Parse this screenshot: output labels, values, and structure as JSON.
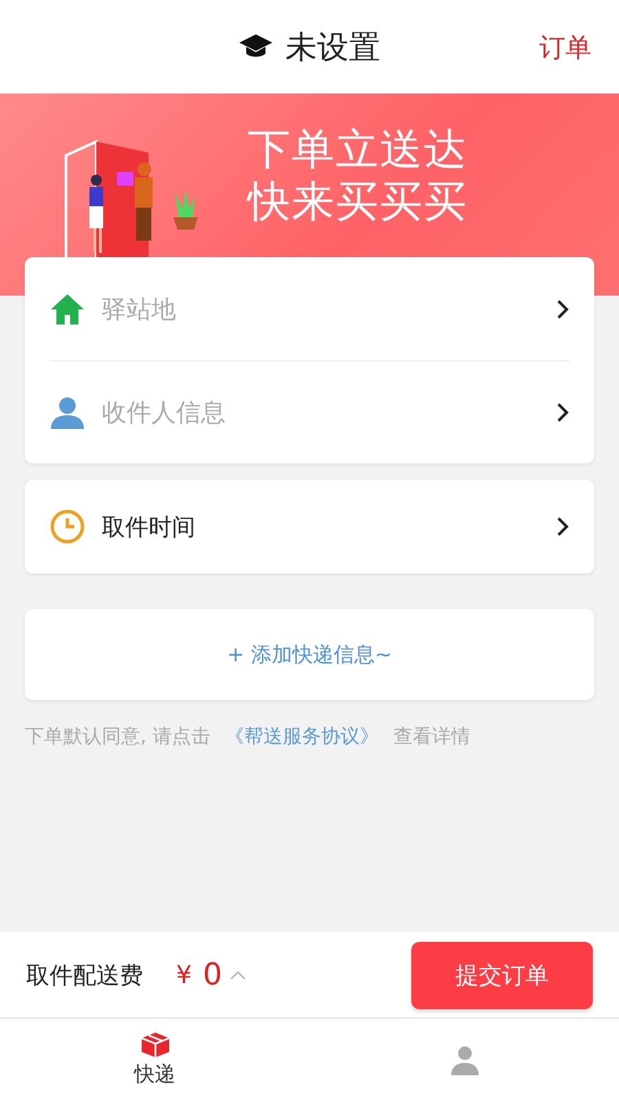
{
  "header": {
    "title": "未设置",
    "action": "订单"
  },
  "banner": {
    "lines": [
      "下单立送达",
      "快来买买买"
    ]
  },
  "address_card": [
    {
      "kind": "station",
      "placeholder": "驿站地"
    },
    {
      "kind": "recipient",
      "placeholder": "收件人信息"
    }
  ],
  "pickup_time": {
    "label": "取件时间"
  },
  "add_express": {
    "label": "+ 添加快递信息~"
  },
  "agreement": {
    "before": "下单默认同意, 请点击",
    "link": "《帮送服务协议》",
    "after": "查看详情"
  },
  "footer": {
    "fee_label": "取件配送费",
    "currency": "¥",
    "amount": "0",
    "submit": "提交订单"
  },
  "tabs": [
    {
      "label": "快递",
      "selected": true,
      "kind": "box"
    },
    {
      "selected": false,
      "kind": "person"
    }
  ]
}
